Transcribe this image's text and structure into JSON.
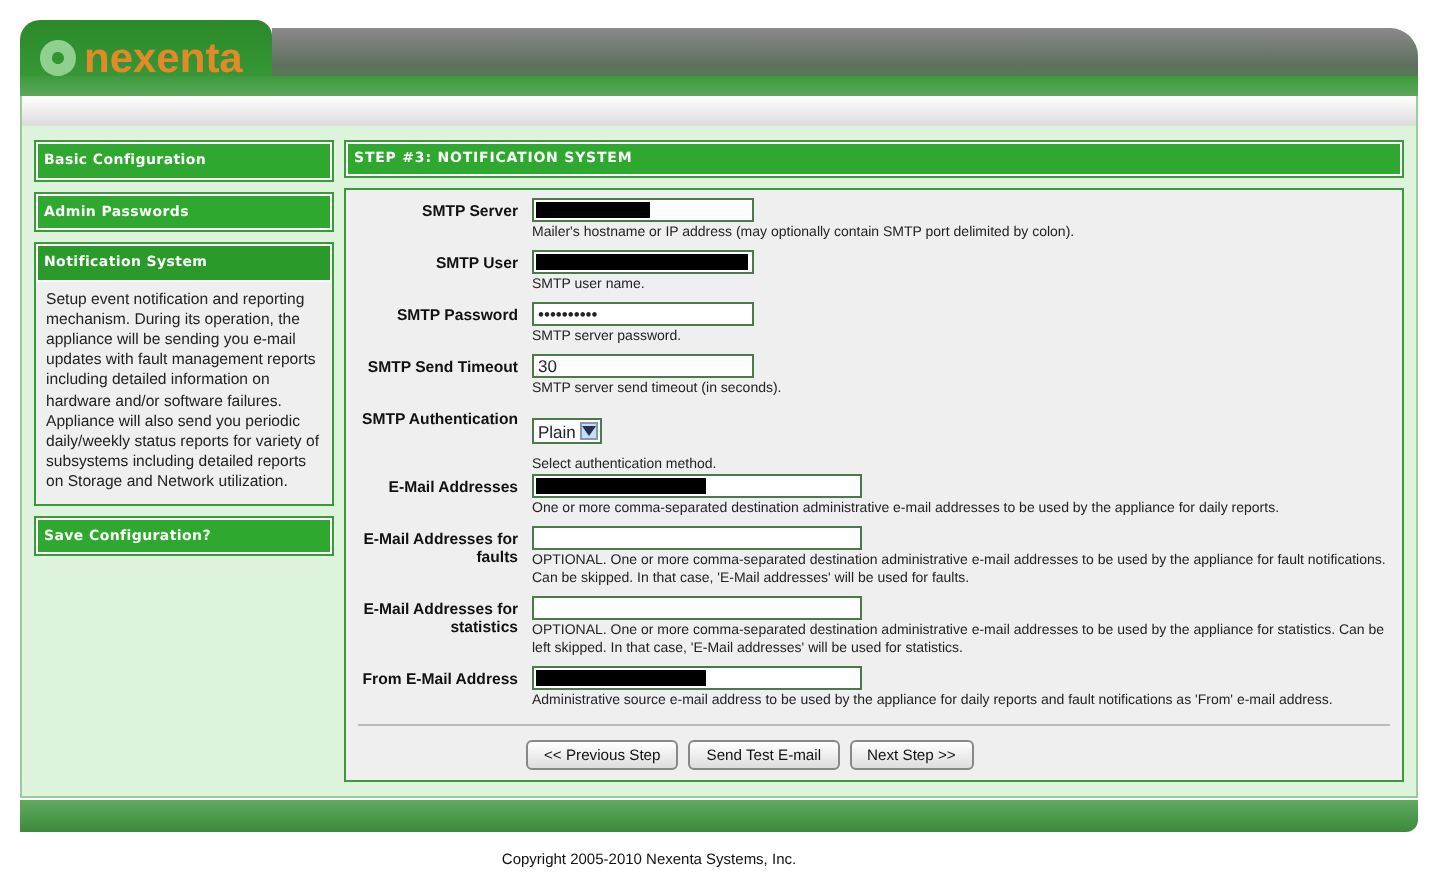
{
  "logo": {
    "text": "nexenta"
  },
  "sidebar": [
    {
      "title": "Basic Configuration",
      "selected": false
    },
    {
      "title": "Admin Passwords",
      "selected": false
    },
    {
      "title": "Notification System",
      "selected": true,
      "description": "Setup event notification and reporting mechanism. During its operation, the appliance will be sending you e-mail updates with fault management reports including detailed information on hardware and/or software failures. Appliance will also send you periodic daily/weekly status reports for variety of subsystems including detailed reports on Storage and Network utilization."
    },
    {
      "title": "Save Configuration?",
      "selected": false
    }
  ],
  "panel": {
    "title": "STEP #3: NOTIFICATION SYSTEM",
    "fields": [
      {
        "label": "SMTP Server",
        "kind": "redacted_partial",
        "hint": "Mailer's hostname or IP address (may optionally contain SMTP port delimited by colon)."
      },
      {
        "label": "SMTP User",
        "kind": "redacted_full",
        "hint": "SMTP user name."
      },
      {
        "label": "SMTP Password",
        "kind": "password",
        "value": "••••••••••",
        "hint": "SMTP server password."
      },
      {
        "label": "SMTP Send Timeout",
        "kind": "text",
        "value": "30",
        "hint": "SMTP server send timeout (in seconds)."
      },
      {
        "label": "SMTP Authentication",
        "kind": "select",
        "value": "Plain",
        "hint": "Select authentication method."
      },
      {
        "label": "E-Mail Addresses",
        "kind": "redacted_partial",
        "wide": true,
        "hint": "One or more comma-separated destination administrative e-mail addresses to be used by the appliance for daily reports."
      },
      {
        "label": "E-Mail Addresses for faults",
        "kind": "text",
        "wide": true,
        "hint": "OPTIONAL. One or more comma-separated destination administrative e-mail addresses to be used by the appliance for fault notifications. Can be skipped. In that case, 'E-Mail addresses' will be used for faults."
      },
      {
        "label": "E-Mail Addresses for statistics",
        "kind": "text",
        "wide": true,
        "hint": "OPTIONAL. One or more comma-separated destination administrative e-mail addresses to be used by the appliance for statistics. Can be left skipped. In that case, 'E-Mail addresses' will be used for statistics."
      },
      {
        "label": "From E-Mail Address",
        "kind": "redacted_partial",
        "wide": true,
        "hint": "Administrative source e-mail address to be used by the appliance for daily reports and fault notifications as 'From' e-mail address."
      }
    ],
    "buttons": [
      "<< Previous Step",
      "Send Test E-mail",
      "Next Step >>"
    ]
  },
  "footer": {
    "copyright": "Copyright 2005-2010 Nexenta Systems, Inc."
  }
}
